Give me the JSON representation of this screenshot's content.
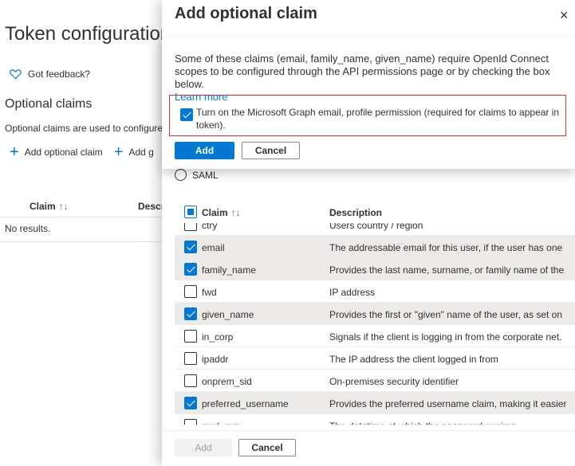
{
  "background": {
    "title": "Token configuration",
    "feedback_label": "Got feedback?",
    "section_title": "Optional claims",
    "description": "Optional claims are used to configure",
    "toolbar": {
      "add_optional_claim": "Add optional claim",
      "add_groups_claim": "Add g"
    },
    "table": {
      "col_claim": "Claim",
      "col_desc": "Descr",
      "sort_arrows": "↑↓",
      "empty_text": "No results."
    }
  },
  "panel": {
    "title": "Add optional claim",
    "close_glyph": "×",
    "saml_label": "SAML",
    "table": {
      "col_claim": "Claim",
      "col_desc": "Description",
      "sort_arrows": "↑↓"
    },
    "rows": [
      {
        "claim": "ctry",
        "desc": "Users country / region",
        "checked": false
      },
      {
        "claim": "email",
        "desc": "The addressable email for this user, if the user has one",
        "checked": true
      },
      {
        "claim": "family_name",
        "desc": "Provides the last name, surname, or family name of the",
        "checked": true
      },
      {
        "claim": "fwd",
        "desc": "IP address",
        "checked": false
      },
      {
        "claim": "given_name",
        "desc": "Provides the first or \"given\" name of the user, as set on",
        "checked": true
      },
      {
        "claim": "in_corp",
        "desc": "Signals if the client is logging in from the corporate net.",
        "checked": false
      },
      {
        "claim": "ipaddr",
        "desc": "The IP address the client logged in from",
        "checked": false
      },
      {
        "claim": "onprem_sid",
        "desc": "On-premises security identifier",
        "checked": false
      },
      {
        "claim": "preferred_username",
        "desc": "Provides the preferred username claim, making it easier",
        "checked": true
      },
      {
        "claim": "pwd_exp",
        "desc": "The datetime at which the password expires",
        "checked": false
      }
    ],
    "footer": {
      "add_label": "Add",
      "cancel_label": "Cancel"
    }
  },
  "callout": {
    "message": "Some of these claims (email, family_name, given_name) require OpenId Connect scopes to be configured through the API permissions page or by checking the box below.",
    "learn_more": "Learn more",
    "checkbox_label": "Turn on the Microsoft Graph email, profile permission (required for claims to appear in token).",
    "checkbox_checked": true,
    "add_label": "Add",
    "cancel_label": "Cancel"
  },
  "colors": {
    "accent": "#0078d4",
    "highlight_border": "#d13438",
    "selected_row": "#edebe9"
  }
}
